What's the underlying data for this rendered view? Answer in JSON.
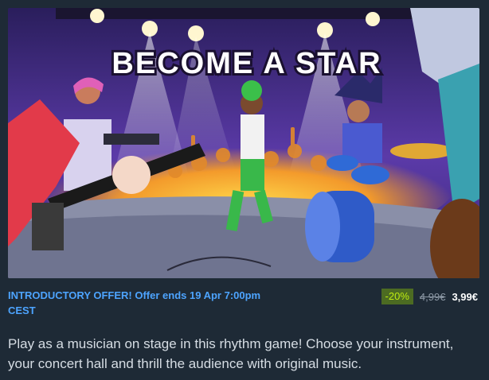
{
  "capsule": {
    "title_art": "BECOME A STAR"
  },
  "offer": {
    "text": "INTRODUCTORY OFFER! Offer ends 19 Apr 7:00pm CEST",
    "discount": "-20%",
    "original_price": "4,99€",
    "final_price": "3,99€"
  },
  "description": "Play as a musician on stage in this rhythm game! Choose your instrument, your concert hall and thrill the audience with original music.",
  "colors": {
    "offer_text": "#4da4ff",
    "discount_bg": "#4c6b22",
    "discount_text": "#beee11",
    "background": "#1e2a36"
  }
}
